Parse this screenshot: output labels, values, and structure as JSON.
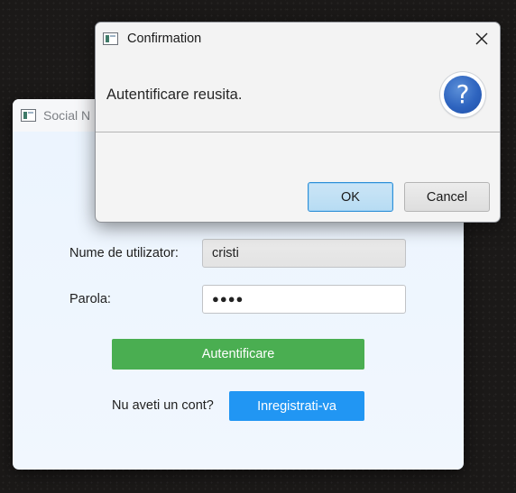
{
  "login_window": {
    "title": "Social N",
    "username_label": "Nume de utilizator:",
    "username_value": "cristi",
    "password_label": "Parola:",
    "password_value": "●●●●",
    "login_button": "Autentificare",
    "no_account_text": "Nu aveti un cont?",
    "register_button": "Inregistrati-va"
  },
  "dialog": {
    "title": "Confirmation",
    "header_text": "Autentificare reusita.",
    "icon": "question-icon",
    "icon_glyph": "?",
    "ok_label": "OK",
    "cancel_label": "Cancel",
    "close_icon": "close-icon"
  },
  "colors": {
    "login_button": "#4aae51",
    "register_button": "#2196f3",
    "question_icon": "#2e64bf",
    "ok_border": "#2f8fd6"
  }
}
